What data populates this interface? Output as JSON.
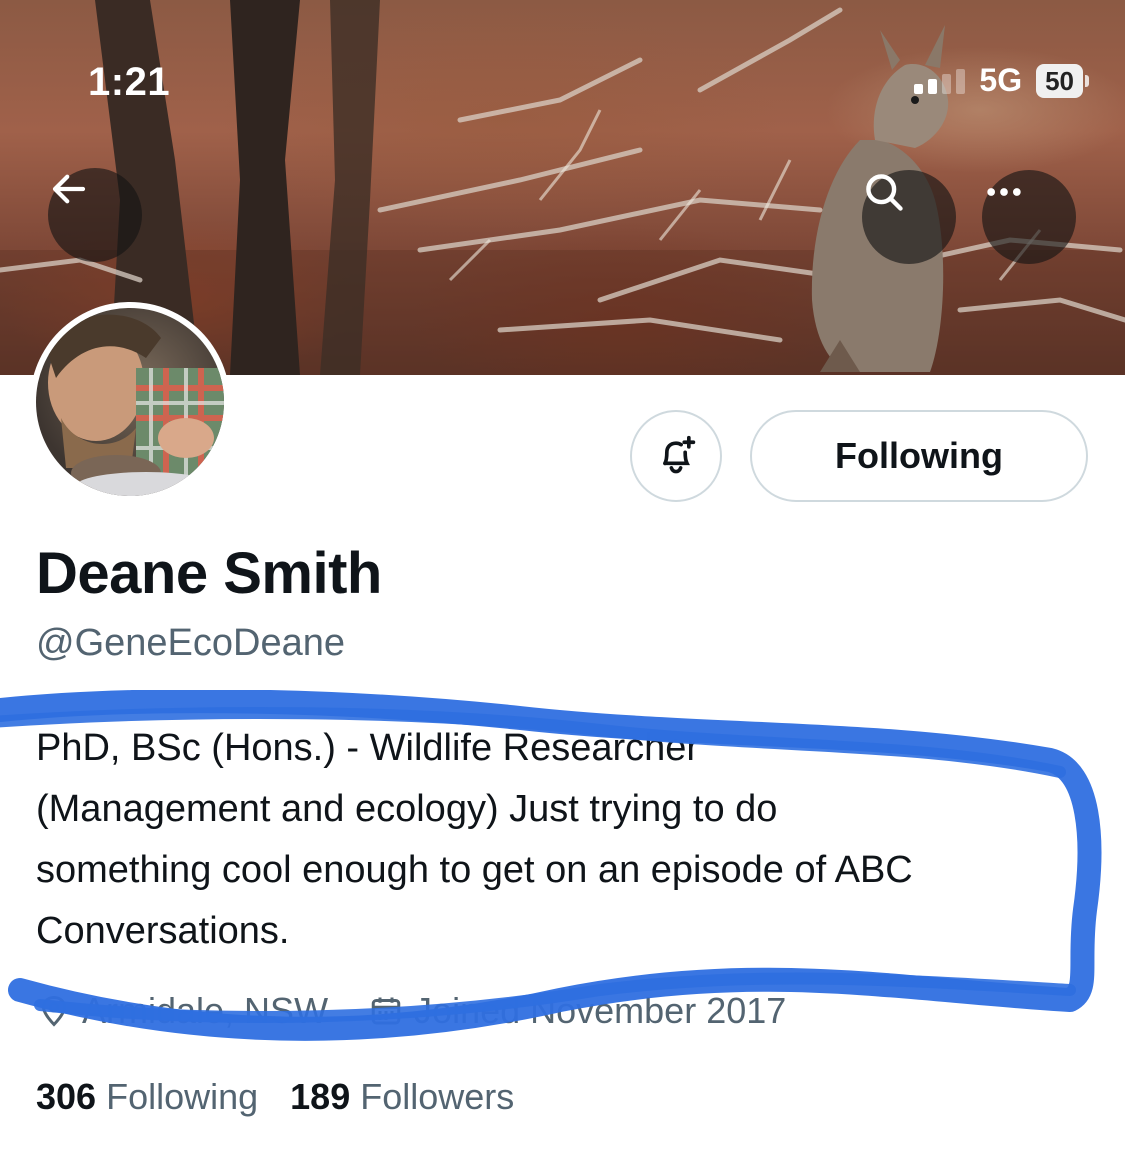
{
  "status_bar": {
    "time": "1:21",
    "network": "5G",
    "battery": "50"
  },
  "banner": {
    "alt": "banner photo"
  },
  "toolbar": {
    "back_icon": "arrow-left-icon",
    "search_icon": "search-icon",
    "more_icon": "more-icon"
  },
  "profile": {
    "display_name": "Deane Smith",
    "handle": "@GeneEcoDeane",
    "bio_line_1": "PhD, BSc (Hons.) - Wildlife Researcher",
    "bio_line_2": "(Management and ecology) Just trying to do",
    "bio_line_3": "something cool enough to get on an episode of ABC",
    "bio_line_4": "Conversations.",
    "location": "Armidale, NSW",
    "joined": "Joined November 2017"
  },
  "actions": {
    "notify_icon": "bell-plus-icon",
    "following_label": "Following"
  },
  "counts": {
    "following_count": "306",
    "following_label": "Following",
    "followers_count": "189",
    "followers_label": "Followers"
  },
  "colors": {
    "scribble": "#2f6fe0",
    "secondary_text": "#536471",
    "border": "#cfd9de"
  }
}
